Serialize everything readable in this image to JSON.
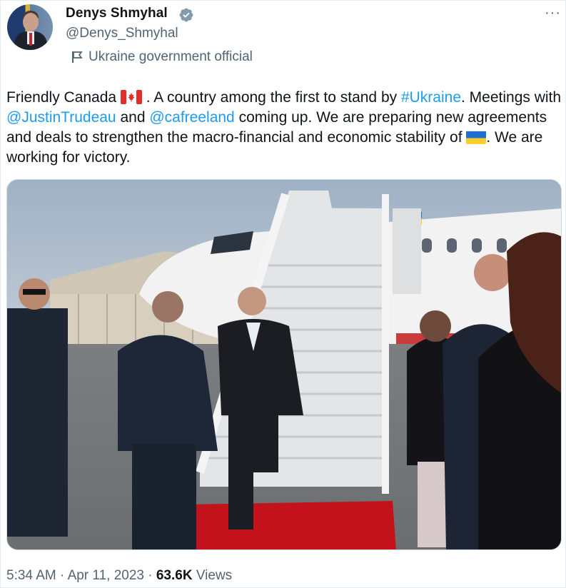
{
  "tweet": {
    "author_name": "Denys Shmyhal",
    "author_handle": "@Denys_Shmyhal",
    "affiliation": "Ukraine government official",
    "more_label": "···",
    "text": {
      "p1": "Friendly Canada ",
      "p2": " . A country among the first to stand by ",
      "hashtag": "#Ukraine",
      "p3": ". Meetings with ",
      "mention1": "@JustinTrudeau",
      "p4": " and ",
      "mention2": "@cafreeland",
      "p5": " coming up. We are preparing new agreements and deals to strengthen the macro-financial and economic stability of ",
      "p6": ". We are working for victory."
    },
    "time": "5:34 AM",
    "sep1": " · ",
    "date": "Apr 11, 2023",
    "sep2": " · ",
    "views_count": "63.6K",
    "views_label": " Views"
  },
  "icons": {
    "verified": "verified-badge-icon",
    "affiliation": "flag-icon",
    "more": "more-icon"
  },
  "colors": {
    "link": "#1d9bf0",
    "secondary_text": "#536471",
    "verified_badge": "#829aab"
  }
}
